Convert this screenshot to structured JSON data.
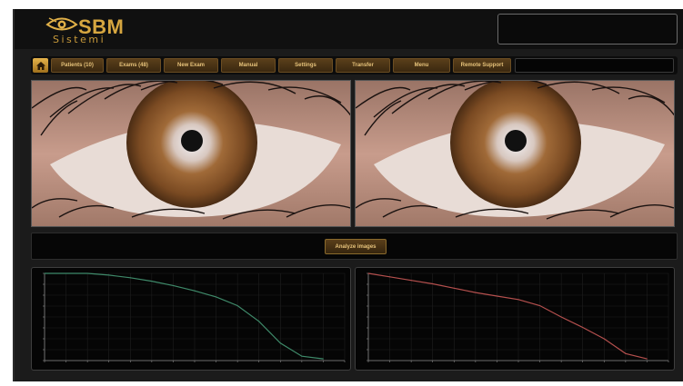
{
  "header": {
    "brand": "SBM",
    "brand_sub": "Sistemi"
  },
  "nav": {
    "home_icon": "home-icon",
    "items": [
      {
        "label": "Patients (10)"
      },
      {
        "label": "Exams (48)"
      },
      {
        "label": "New Exam"
      },
      {
        "label": "Manual"
      },
      {
        "label": "Settings"
      },
      {
        "label": "Transfer"
      },
      {
        "label": "Menu"
      },
      {
        "label": "Remote Support"
      }
    ]
  },
  "actions": {
    "analyze_label": "Analyze images"
  },
  "colors": {
    "accent": "#d6a640",
    "left_curve": "#3f8a6a",
    "right_curve": "#b5504e"
  },
  "chart_data": [
    {
      "type": "line",
      "series": [
        {
          "values": [
            100,
            100,
            100,
            98,
            95,
            91,
            86,
            80,
            73,
            63,
            45,
            20,
            5,
            2
          ]
        }
      ],
      "x": [
        0,
        1,
        2,
        3,
        4,
        5,
        6,
        7,
        8,
        9,
        10,
        11,
        12,
        13
      ],
      "xlim": [
        0,
        14
      ],
      "ylim": [
        0,
        100
      ],
      "grid": true
    },
    {
      "type": "line",
      "series": [
        {
          "values": [
            100,
            96,
            92,
            88,
            83,
            78,
            74,
            70,
            63,
            50,
            38,
            25,
            8,
            2
          ]
        }
      ],
      "x": [
        0,
        1,
        2,
        3,
        4,
        5,
        6,
        7,
        8,
        9,
        10,
        11,
        12,
        13
      ],
      "xlim": [
        0,
        14
      ],
      "ylim": [
        0,
        100
      ],
      "grid": true
    }
  ]
}
